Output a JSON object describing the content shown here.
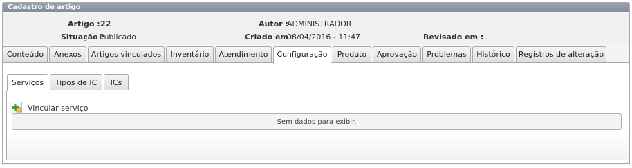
{
  "panel": {
    "title": "Cadastro de artigo"
  },
  "info": {
    "artigo_label": "Artigo :",
    "artigo_value": "22",
    "autor_label": "Autor :",
    "autor_value": "ADMINISTRADOR",
    "situacao_label": "Situação :",
    "situacao_value": "Publicado",
    "criado_label": "Criado em :",
    "criado_value": "08/04/2016 - 11:47",
    "revisado_label": "Revisado em :",
    "revisado_value": "-"
  },
  "tabs": [
    {
      "label": "Conteúdo"
    },
    {
      "label": "Anexos"
    },
    {
      "label": "Artigos vinculados"
    },
    {
      "label": "Inventário"
    },
    {
      "label": "Atendimento"
    },
    {
      "label": "Configuração"
    },
    {
      "label": "Produto"
    },
    {
      "label": "Aprovação"
    },
    {
      "label": "Problemas"
    },
    {
      "label": "Histórico"
    },
    {
      "label": "Registros de alteração"
    }
  ],
  "active_tab": "Configuração",
  "subtabs": [
    {
      "label": "Serviços"
    },
    {
      "label": "Tipos de IC"
    },
    {
      "label": "ICs"
    }
  ],
  "active_subtab": "Serviços",
  "actions": {
    "add_label": "Vincular serviço",
    "add_icon": "add-link-icon"
  },
  "grid": {
    "empty_message": "Sem dados para exibir."
  },
  "colors": {
    "title_bar": "#8c97a3",
    "border": "#a9a9a9",
    "icon_green": "#3aa13a"
  }
}
